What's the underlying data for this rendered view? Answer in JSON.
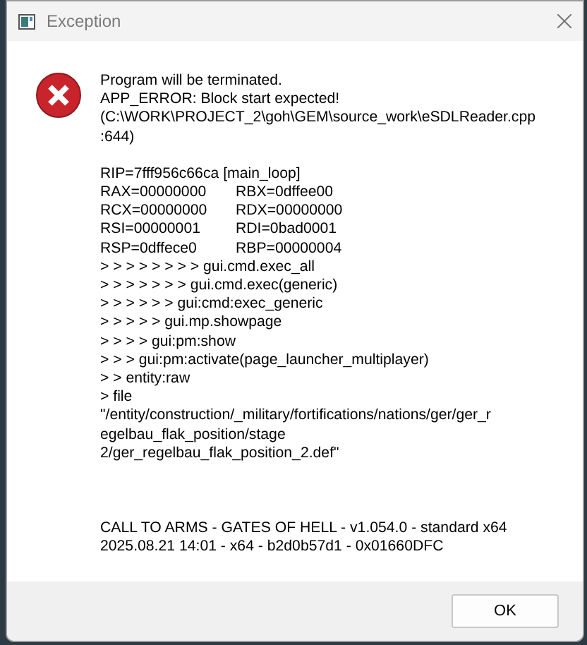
{
  "window": {
    "title": "Exception"
  },
  "message": [
    "Program will be terminated.",
    "APP_ERROR: Block start expected!",
    "(C:\\WORK\\PROJECT_2\\goh\\GEM\\source_work\\eSDLReader.cpp",
    ":644)"
  ],
  "registers_header": "RIP=7fff956c66ca [main_loop]",
  "registers": [
    [
      "RAX=00000000",
      "RBX=0dffee00"
    ],
    [
      "RCX=00000000",
      "RDX=00000000"
    ],
    [
      "RSI=00000001",
      "RDI=0bad0001"
    ],
    [
      "RSP=0dffece0",
      "RBP=00000004"
    ]
  ],
  "stack": [
    "> > > > > > > > gui.cmd.exec_all",
    "> > > > > > > gui.cmd.exec(generic)",
    "> > > > > > gui:cmd:exec_generic",
    "> > > > > gui.mp.showpage",
    "> > > > gui:pm:show",
    "> > > gui:pm:activate(page_launcher_multiplayer)",
    "> > entity:raw",
    "> file",
    "\"/entity/construction/_military/fortifications/nations/ger/ger_r",
    "egelbau_flak_position/stage",
    "2/ger_regelbau_flak_position_2.def\""
  ],
  "footer": [
    "CALL TO ARMS - GATES OF HELL - v1.054.0 - standard x64",
    "2025.08.21 14:01 - x64 - b2d0b57d1 - 0x01660DFC"
  ],
  "buttons": [
    {
      "label": "OK"
    }
  ]
}
